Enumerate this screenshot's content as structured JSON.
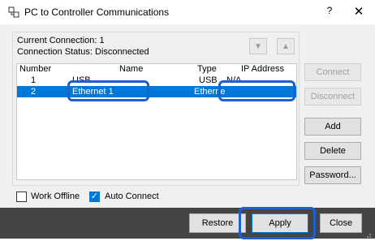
{
  "window": {
    "title": "PC to Controller Communications",
    "help_label": "?",
    "close_label": "✕"
  },
  "status": {
    "current_connection": "Current Connection: 1",
    "connection_status": "Connection Status: Disconnected"
  },
  "table": {
    "columns": [
      "Number",
      "Name",
      "Type",
      "IP Address"
    ],
    "rows": [
      {
        "number": "1",
        "name": "USB",
        "type": "USB",
        "ip": "N/A"
      },
      {
        "number": "2",
        "name": "Ethernet 1",
        "type": "Etherne",
        "ip": ""
      }
    ],
    "selected_row": 1
  },
  "side_buttons": {
    "connect": "Connect",
    "disconnect": "Disconnect",
    "add": "Add",
    "delete": "Delete",
    "password": "Password..."
  },
  "options": {
    "work_offline": "Work Offline",
    "work_offline_checked": false,
    "auto_connect": "Auto Connect",
    "auto_connect_checked": true
  },
  "footer": {
    "restore": "Restore",
    "apply": "Apply",
    "close": "Close"
  },
  "colors": {
    "selection": "#0078d7",
    "callout": "#1e5fd1",
    "footer_bg": "#454545"
  }
}
